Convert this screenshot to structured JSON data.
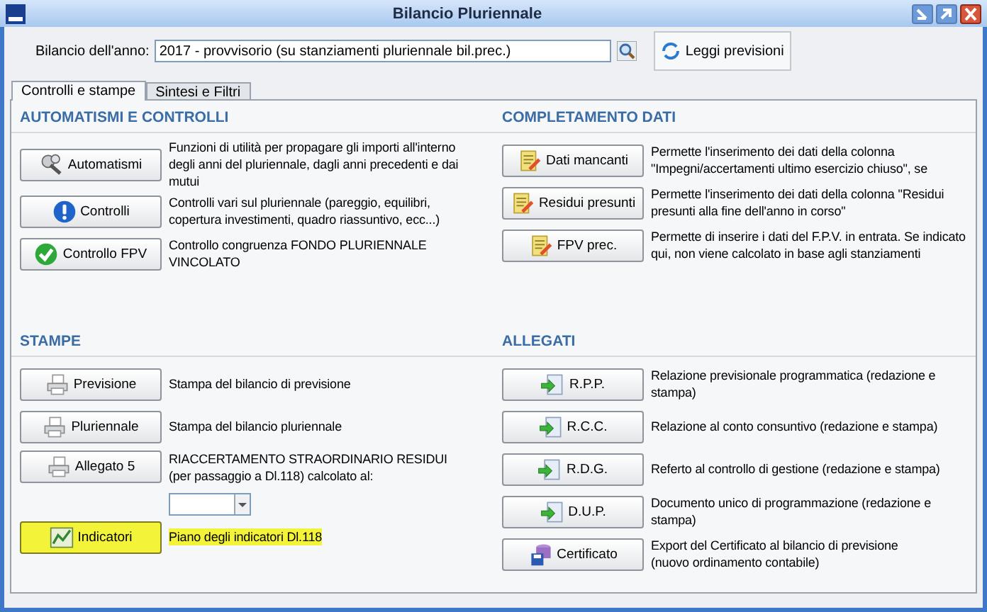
{
  "window": {
    "title": "Bilancio Pluriennale"
  },
  "toolbar": {
    "label": "Bilancio dell'anno:",
    "year_field": {
      "value": "2017 - provvisorio (su stanziamenti pluriennale bil.prec.)"
    },
    "read_button": "Leggi previsioni"
  },
  "tabs": [
    {
      "label": "Controlli e stampe",
      "selected": true
    },
    {
      "label": "Sintesi e Filtri",
      "selected": false
    }
  ],
  "columns": [
    {
      "sections": [
        {
          "title": "AUTOMATISMI E CONTROLLI",
          "items": [
            {
              "kind": "button",
              "label": "Automatismi",
              "description": "Funzioni di utilità per propagare gli importi all'interno degli anni del pluriennale, dagli anni precedenti e dai mutui",
              "highlighted": false
            },
            {
              "kind": "button",
              "label": "Controlli",
              "description": "Controlli vari sul pluriennale (pareggio, equilibri, copertura investimenti, quadro riassuntivo, ecc...)",
              "highlighted": false
            },
            {
              "kind": "button",
              "label": "Controllo FPV",
              "description": "Controllo congruenza FONDO PLURIENNALE VINCOLATO",
              "highlighted": false
            }
          ]
        },
        {
          "title": "STAMPE",
          "items": [
            {
              "kind": "button",
              "label": "Previsione",
              "description": "Stampa del bilancio di previsione",
              "highlighted": false
            },
            {
              "kind": "button",
              "label": "Pluriennale",
              "description": "Stampa del bilancio pluriennale",
              "highlighted": false
            },
            {
              "kind": "button-with-date",
              "label": "Allegato 5",
              "description": "RIACCERTAMENTO STRAORDINARIO RESIDUI\n(per passaggio a Dl.118) calcolato al:",
              "highlighted": false
            },
            {
              "kind": "button",
              "label": "Indicatori",
              "description": "Piano degli indicatori Dl.118",
              "highlighted": true
            }
          ]
        }
      ]
    },
    {
      "sections": [
        {
          "title": "COMPLETAMENTO DATI",
          "items": [
            {
              "kind": "button",
              "label": "Dati mancanti",
              "description": "Permette l'inserimento dei dati della colonna \"Impegni/accertamenti ultimo esercizio chiuso\", se",
              "highlighted": false
            },
            {
              "kind": "button",
              "label": "Residui presunti",
              "description": "Permette l'inserimento dei dati della colonna \"Residui presunti alla fine dell'anno in corso\"",
              "highlighted": false
            },
            {
              "kind": "button",
              "label": "FPV prec.",
              "description": "Permette di inserire i dati del F.P.V. in entrata. Se indicato qui, non viene calcolato in base agli stanziamenti",
              "highlighted": false
            }
          ]
        },
        {
          "title": "ALLEGATI",
          "items": [
            {
              "kind": "button",
              "label": "R.P.P.",
              "description": "Relazione previsionale programmatica (redazione e stampa)",
              "highlighted": false
            },
            {
              "kind": "button",
              "label": "R.C.C.",
              "description": "Relazione al conto consuntivo (redazione e stampa)",
              "highlighted": false
            },
            {
              "kind": "button",
              "label": "R.D.G.",
              "description": "Referto al controllo di gestione (redazione e stampa)",
              "highlighted": false
            },
            {
              "kind": "button",
              "label": "D.U.P.",
              "description": "Documento unico di programmazione (redazione e stampa)",
              "highlighted": false
            },
            {
              "kind": "button",
              "label": "Certificato",
              "description": "Export del Certificato al bilancio di previsione\n(nuovo ordinamento contabile)",
              "highlighted": false
            }
          ]
        }
      ]
    }
  ]
}
